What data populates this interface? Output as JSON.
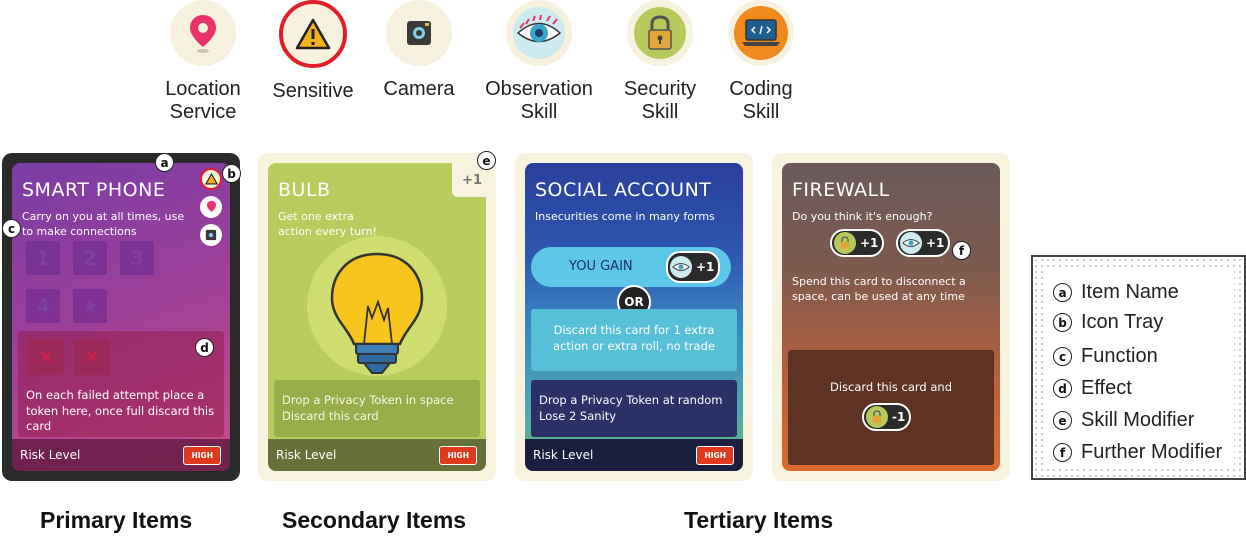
{
  "legend_icons": [
    {
      "label": "Location\nService",
      "icon": "location-pin-icon",
      "color": "#e8336a"
    },
    {
      "label": "Sensitive",
      "icon": "warning-icon",
      "color": "#f2b21c"
    },
    {
      "label": "Camera",
      "icon": "camera-icon",
      "color": "#3a3a3a"
    },
    {
      "label": "Observation\nSkill",
      "icon": "eye-icon",
      "color": "#3aa6c4"
    },
    {
      "label": "Security\nSkill",
      "icon": "padlock-icon",
      "color": "#d99b2a"
    },
    {
      "label": "Coding\nSkill",
      "icon": "laptop-code-icon",
      "color": "#f08a1c"
    }
  ],
  "cards": {
    "smart_phone": {
      "title": "SMART PHONE",
      "function": "Carry on you at all times, use to make connections",
      "slots": [
        "1",
        "2",
        "3",
        "4",
        "★"
      ],
      "effect": "On each failed attempt place a token here, once full discard this card",
      "risk_label": "Risk Level",
      "risk_value": "HIGH"
    },
    "bulb": {
      "title": "BULB",
      "modifier": "+1",
      "function": "Get one extra action every turn!",
      "effect": "Drop a Privacy Token in space Discard this card",
      "risk_label": "Risk Level",
      "risk_value": "HIGH"
    },
    "social_account": {
      "title": "SOCIAL ACCOUNT",
      "function": "Insecurities come in many forms",
      "gain_label": "YOU GAIN",
      "gain_value": "+1",
      "or_label": "OR",
      "alt_effect": "Discard this card for 1 extra action or extra roll, no trade",
      "effect": "Drop a Privacy Token at random Lose 2 Sanity",
      "risk_label": "Risk Level",
      "risk_value": "HIGH"
    },
    "firewall": {
      "title": "FIREWALL",
      "function": "Do you think it's enough?",
      "mod_security": "+1",
      "mod_observation": "+1",
      "description": "Spend this card to disconnect a space, can be used at any time",
      "effect": "Discard this card and",
      "effect_value": "-1"
    }
  },
  "markers": {
    "a": "a",
    "b": "b",
    "c": "c",
    "d": "d",
    "e": "e",
    "f": "f"
  },
  "key": [
    {
      "marker": "a",
      "text": "Item Name"
    },
    {
      "marker": "b",
      "text": "Icon Tray"
    },
    {
      "marker": "c",
      "text": "Function"
    },
    {
      "marker": "d",
      "text": "Effect"
    },
    {
      "marker": "e",
      "text": "Skill Modifier"
    },
    {
      "marker": "f",
      "text": "Further Modifier"
    }
  ],
  "groups": {
    "primary": "Primary Items",
    "secondary": "Secondary Items",
    "tertiary": "Tertiary Items"
  }
}
